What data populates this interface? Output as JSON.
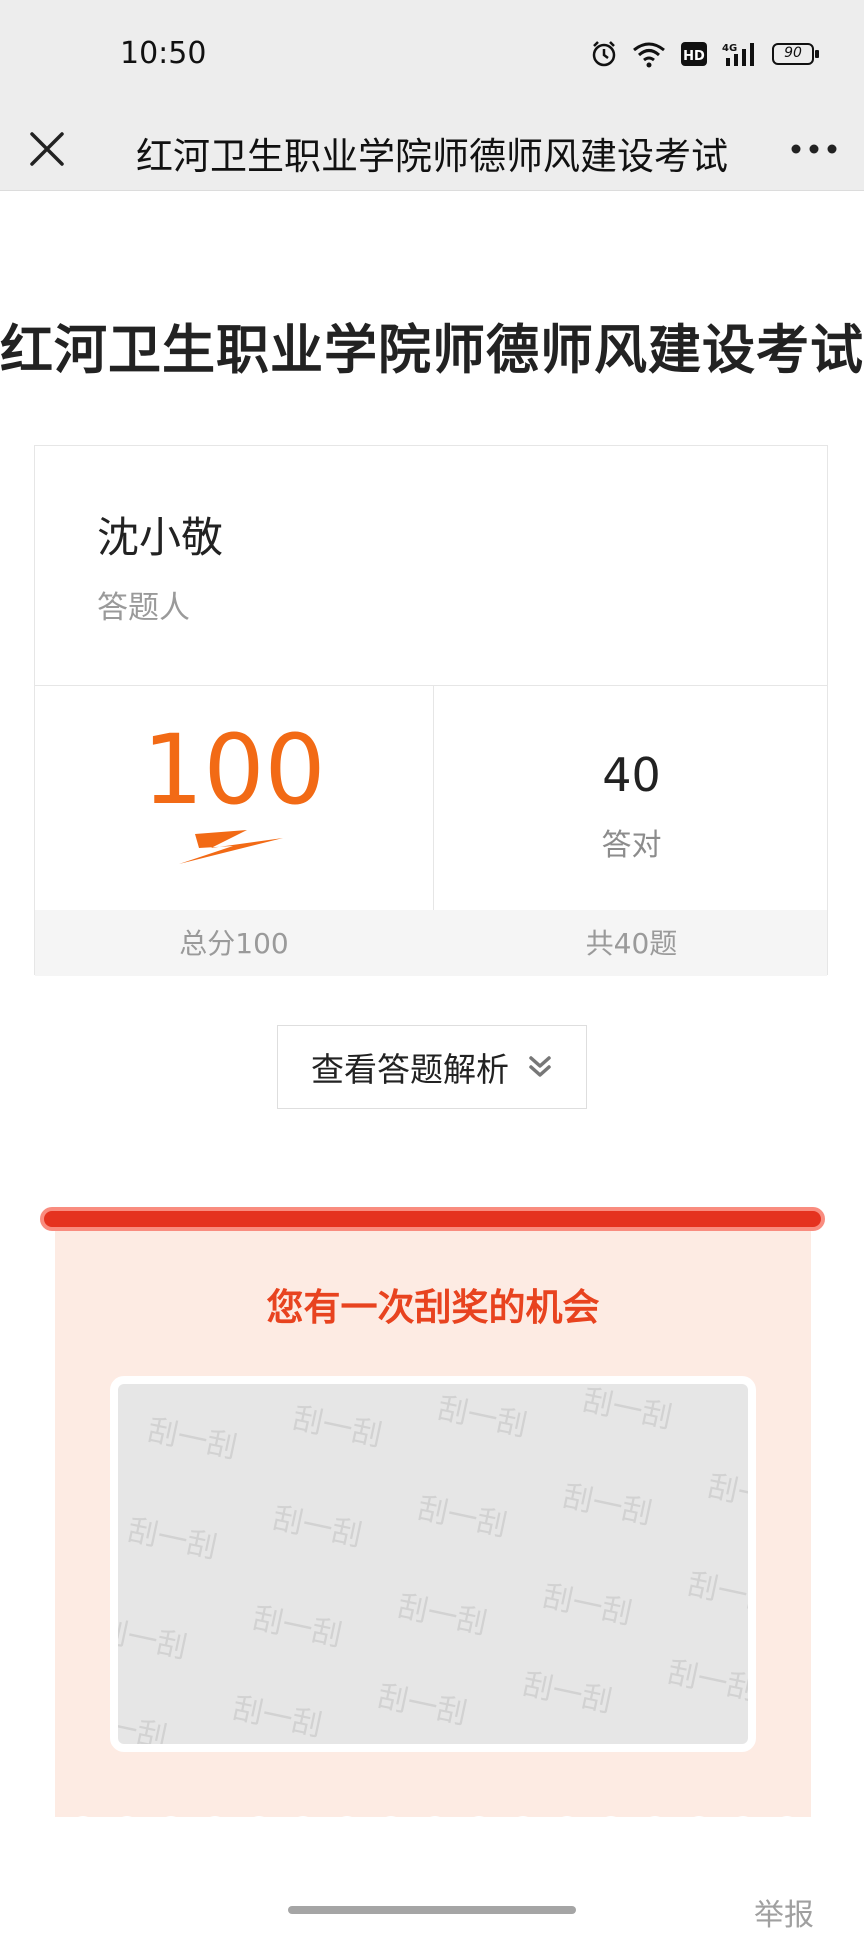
{
  "status_bar": {
    "time": "10:50",
    "battery": "90"
  },
  "nav": {
    "title": "红河卫生职业学院师德师风建设考试"
  },
  "exam": {
    "title": "红河卫生职业学院师德师风建设考试"
  },
  "respondent": {
    "name": "沈小敬",
    "label": "答题人"
  },
  "result": {
    "score": "100",
    "correct_count": "40",
    "correct_label": "答对",
    "total_score": "总分100",
    "total_questions": "共40题"
  },
  "analysis_button": {
    "label": "查看答题解析"
  },
  "prize": {
    "title": "您有一次刮奖的机会",
    "scratch_text": "刮一刮"
  },
  "footer": {
    "report": "举报"
  },
  "colors": {
    "accent": "#f26a15",
    "prize_red": "#e5321f",
    "prize_bg": "#fdebe3"
  }
}
